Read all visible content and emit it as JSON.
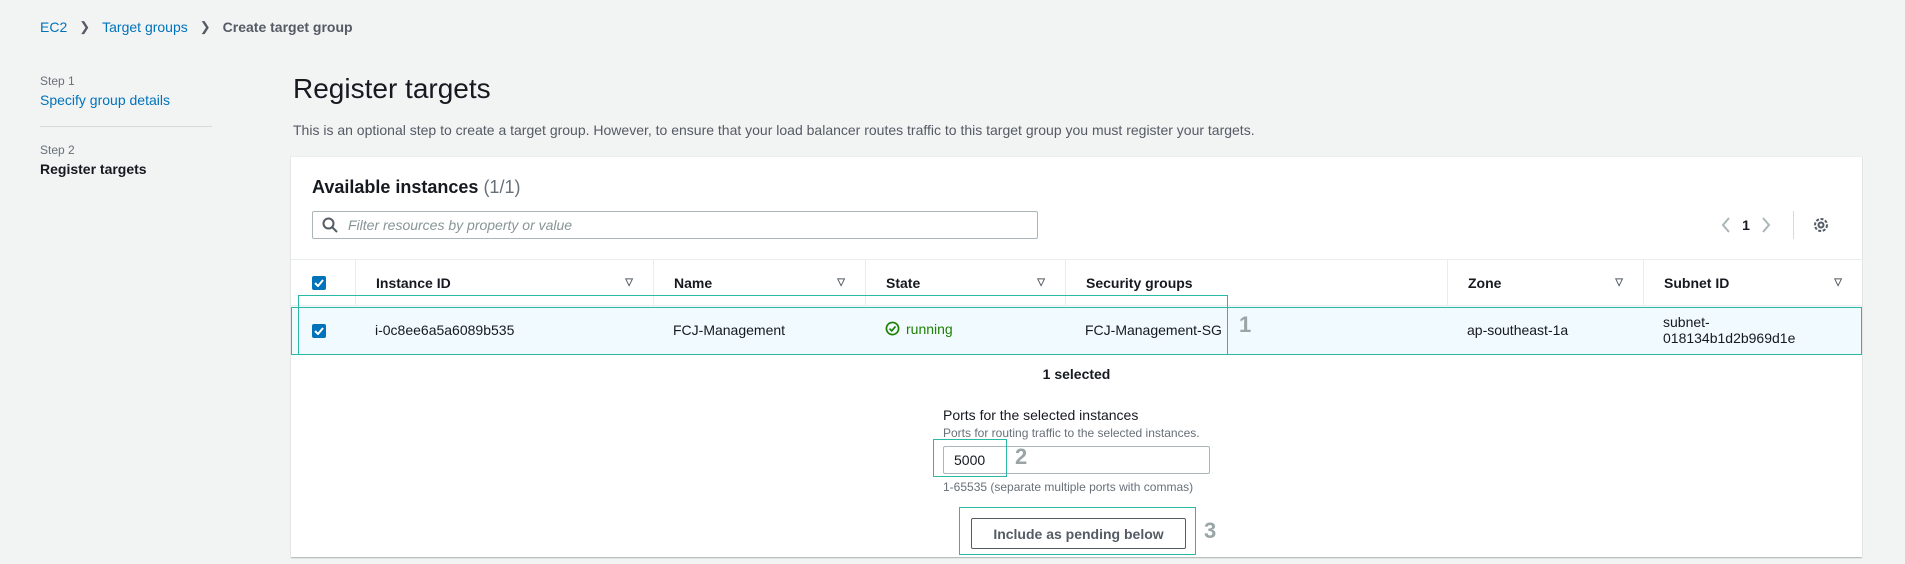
{
  "breadcrumb": {
    "items": [
      "EC2",
      "Target groups"
    ],
    "current": "Create target group"
  },
  "steps": [
    {
      "num": "Step 1",
      "title": "Specify group details"
    },
    {
      "num": "Step 2",
      "title": "Register targets"
    }
  ],
  "page": {
    "title": "Register targets",
    "description": "This is an optional step to create a target group. However, to ensure that your load balancer routes traffic to this target group you must register your targets."
  },
  "panel": {
    "title": "Available instances",
    "count": "(1/1)",
    "search_placeholder": "Filter resources by property or value",
    "page_number": "1"
  },
  "table": {
    "columns": [
      "Instance ID",
      "Name",
      "State",
      "Security groups",
      "Zone",
      "Subnet ID"
    ],
    "rows": [
      {
        "instance_id": "i-0c8ee6a5a6089b535",
        "name": "FCJ-Management",
        "state": "running",
        "security_groups": "FCJ-Management-SG",
        "zone": "ap-southeast-1a",
        "subnet_line1": "subnet-",
        "subnet_line2": "018134b1d2b969d1e"
      }
    ]
  },
  "selection": {
    "count_text": "1 selected",
    "ports_label": "Ports for the selected instances",
    "ports_sub": "Ports for routing traffic to the selected instances.",
    "port_value": "5000",
    "ports_hint": "1-65535 (separate multiple ports with commas)",
    "include_button": "Include as pending below"
  },
  "annotations": [
    "1",
    "2",
    "3"
  ],
  "colors": {
    "accent": "#0073bb",
    "running": "#1d8102",
    "annotation": "#2bb9a6"
  }
}
